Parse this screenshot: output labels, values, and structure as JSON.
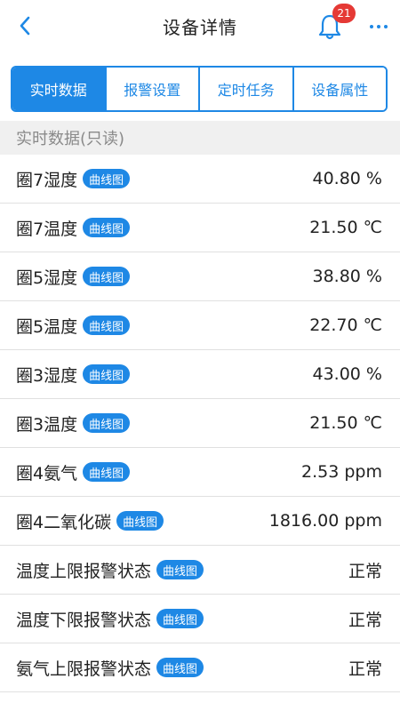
{
  "header": {
    "title": "设备详情",
    "notification_count": "21"
  },
  "tabs": [
    {
      "label": "实时数据",
      "active": true
    },
    {
      "label": "报警设置",
      "active": false
    },
    {
      "label": "定时任务",
      "active": false
    },
    {
      "label": "设备属性",
      "active": false
    }
  ],
  "section_title": "实时数据(只读)",
  "curve_label": "曲线图",
  "rows": [
    {
      "name": "圈7湿度",
      "value": "40.80 %"
    },
    {
      "name": "圈7温度",
      "value": "21.50 ℃"
    },
    {
      "name": "圈5湿度",
      "value": "38.80 %"
    },
    {
      "name": "圈5温度",
      "value": "22.70 ℃"
    },
    {
      "name": "圈3湿度",
      "value": "43.00 %"
    },
    {
      "name": "圈3温度",
      "value": "21.50 ℃"
    },
    {
      "name": "圈4氨气",
      "value": "2.53 ppm"
    },
    {
      "name": "圈4二氧化碳",
      "value": "1816.00 ppm"
    },
    {
      "name": "温度上限报警状态",
      "value": "正常"
    },
    {
      "name": "温度下限报警状态",
      "value": "正常"
    },
    {
      "name": "氨气上限报警状态",
      "value": "正常"
    }
  ],
  "colors": {
    "accent": "#1e88e5",
    "badge": "#e53935",
    "section_bg": "#f0f0f0"
  },
  "icons": {
    "back": "chevron-left-icon",
    "notification": "bell-icon",
    "more": "more-dots-icon"
  }
}
